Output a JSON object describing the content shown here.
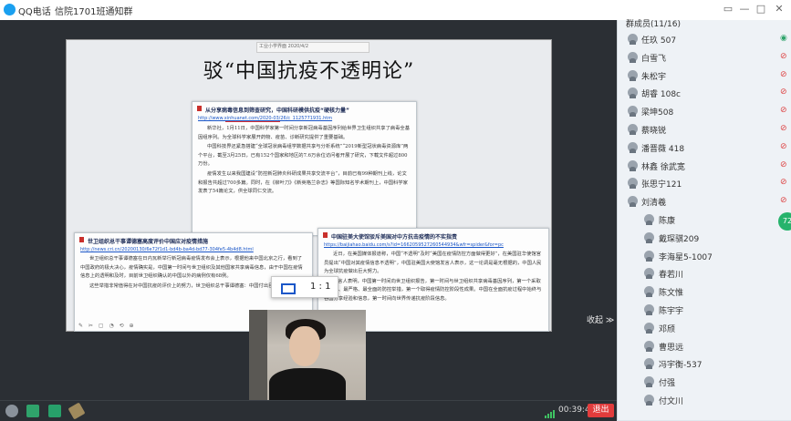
{
  "titlebar": {
    "app_name": "QQ电话",
    "chat_name": "信院1701班通知群",
    "controls": [
      "▭",
      "—",
      "□",
      "✕"
    ]
  },
  "slide": {
    "title": "驳“中国抗疫不透明论”",
    "tab_text": "工业小学界面  2020/4/2"
  },
  "doc1": {
    "heading": "从分享病毒信息到筛查研究，中国科研模供抗疫“硬核力量”",
    "url": "http://www.xinhuanet.com/2020-03/26/c_1125771931.htm",
    "paragraphs": [
      "新华社，1月11日，中国科学家第一时间分享新冠病毒基因序列给世界卫生组织共享了病毒全基因组序列。为全球科学家展开药物、疫苗、诊断研究提供了重要基础。",
      "中国科技界还紧急搭建“全球冠状病毒组学数据共享与分析系统”“2019新型冠状病毒资源库”两个平台，截至3月25日，已有152个国家和地区的7.6万余位访问者开展了研究，下载文件超过800万份。",
      "疫情发生以来我国建设“防控新冠肺炎科研成果共享交流平台”，目前已有99种期刊上线，论文和报告共超过700多篇。同时，在《柳叶刀》《新英格兰杂志》等国际知名学术期刊上，中国科学家发表了54篇论文，供全球同仁交流。"
    ]
  },
  "doc2": {
    "heading": "世卫组织总干事谭德塞高度评价中国应对疫情措施",
    "url": "http://news.cri.cn/20200130/6e72f1d1-bd4b-ba4d-bd77-304fe5-4b4d8.html",
    "paragraphs": [
      "世卫组织总干事谭德塞在日内瓦新举行新冠病毒疫情发布会上表示，根据他来中国北京之行，看到了中国政府的极大决心，疫情确实是，中国第一时间与世卫组织及其他国家共享病毒信息，由于中国在疫情信息上的透明和及时，目前世卫组织确认的中国以外的病例仅有68例。",
      "这些举措非常值得在对中国抗疫的评价上的努力，世卫组织总干事谭德塞：中国付出巨大努力。"
    ],
    "tools": "✎ ✂ ▢ ◔ ⟲ ⊕"
  },
  "doc3": {
    "heading": "中国驻美大使馆驳斥美国对中方抗击疫情的不实指责",
    "url": "https://baijiahao.baidu.com/s?id=1662059527260544934&wfr=spider&for=pc",
    "paragraphs": [
      "近日，在美国媒体报道称，中国“不透明”及时“美国在疫情防控方面做得更好”，在美国驻华使馆官员提出“中国对其疫情信息不透明”，中国驻美国大使馆发言人表示，这一论调是毫无根据的，中国人民为全球抗疫做出巨大努力。",
      "发言人表明，中国第一时间向世卫组织报告，第一时间与世卫组织共享病毒基因序列，第一个采取最有力、最严格、最全面的防控举措，第一个取得疫情防控阶段性成果。中国在全面抗疫过程中始终与各国分享经验和信息，第一时间向世界传递抗疫阶段信息。"
    ]
  },
  "zoom_popup": {
    "ratio": "1 : 1"
  },
  "collapse_label": "收起 ≫",
  "toolbar": {
    "time": "00:39:45",
    "exit_label": "退出",
    "colors": {
      "exit": "#e23c3c",
      "signal": "#3fc262"
    }
  },
  "panel": {
    "title": "群成员(11/16)",
    "members": [
      {
        "name": "任玖 507",
        "mic": "on"
      },
      {
        "name": "白雪飞",
        "mic": "muted"
      },
      {
        "name": "朱松宇",
        "mic": "muted"
      },
      {
        "name": "胡睿 108c",
        "mic": "muted"
      },
      {
        "name": "梁坤508",
        "mic": "muted"
      },
      {
        "name": "蔡晓锐",
        "mic": "muted"
      },
      {
        "name": "潘晋薇 418",
        "mic": "muted"
      },
      {
        "name": "林鑫 徐武宽",
        "mic": "muted"
      },
      {
        "name": "张思宁121",
        "mic": "muted"
      },
      {
        "name": "刘清羲",
        "mic": "muted"
      },
      {
        "name": "陈康",
        "mic": "muted"
      },
      {
        "name": "戴琛骐209",
        "mic": "none"
      },
      {
        "name": "李海星5-1007",
        "mic": "none"
      },
      {
        "name": "春若川",
        "mic": "none"
      },
      {
        "name": "陈文惟",
        "mic": "none"
      },
      {
        "name": "陈宇宇",
        "mic": "none"
      },
      {
        "name": "邓颀",
        "mic": "none"
      },
      {
        "name": "曹思远",
        "mic": "none"
      },
      {
        "name": "冯宇衡-537",
        "mic": "none"
      },
      {
        "name": "付强",
        "mic": "none"
      },
      {
        "name": "付文川",
        "mic": "none"
      }
    ],
    "badge": "72"
  }
}
